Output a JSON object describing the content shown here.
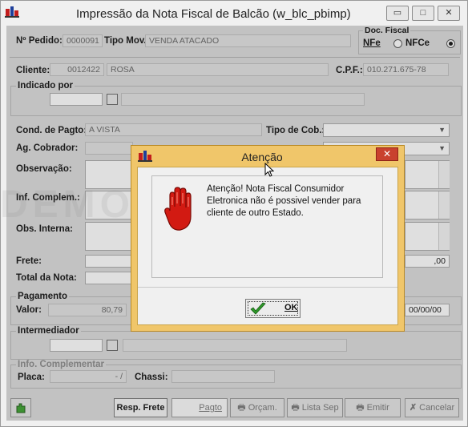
{
  "window": {
    "title": "Impressão da Nota Fiscal de Balcão (w_blc_pbimp)",
    "buttons": {
      "minimize": "▭",
      "maximize": "□",
      "close": "✕"
    }
  },
  "header": {
    "pedido_label": "Nº Pedido:",
    "pedido_value": "0000091",
    "tipo_mov_label": "Tipo Mov.:",
    "tipo_mov_value": "VENDA ATACADO",
    "doc_fiscal_label": "Doc. Fiscal",
    "nfe_label": "NFe",
    "nfce_label": "NFCe",
    "doc_fiscal_selected": "NFe"
  },
  "cliente": {
    "label": "Cliente:",
    "code": "0012422",
    "name": "ROSA",
    "cpf_label": "C.P.F.:",
    "cpf_value": "010.271.675-78"
  },
  "indicado_por": {
    "label": "Indicado por"
  },
  "form": {
    "cond_pagto_label": "Cond. de Pagto:",
    "cond_pagto_value": "A VISTA",
    "tipo_cob_label": "Tipo de Cob.:",
    "ag_cobrador_label": "Ag. Cobrador:",
    "observacao_label": "Observação:",
    "inf_complem_label": "Inf. Complem.:",
    "obs_interna_label": "Obs. Interna:",
    "frete_label": "Frete:",
    "frete_value": ",00",
    "total_nota_label": "Total da Nota:"
  },
  "pagamento": {
    "label": "Pagamento",
    "valor_label": "Valor:",
    "valor_value": "80,79",
    "date_value": "00/00/00"
  },
  "intermediador": {
    "label": "Intermediador"
  },
  "info_complementar": {
    "label": "Info. Complementar",
    "placa_label": "Placa:",
    "placa_value": "- /",
    "chassi_label": "Chassi:"
  },
  "watermark": "DEMO VERSION",
  "toolbar": {
    "resp_frete": "Resp. Frete",
    "pagto": "Pagto",
    "orcam": "Orçam.",
    "lista_sep": "Lista Sep",
    "emitir": "Emitir",
    "cancelar": "Cancelar"
  },
  "dialog": {
    "title": "Atenção",
    "message": "Atenção! Nota Fiscal Consumidor Eletronica não é possivel vender para cliente de outro Estado.",
    "ok_label": "OK",
    "close": "✕",
    "icon": "stop-hand-icon"
  },
  "colors": {
    "dialog_frame": "#f0c66a",
    "dialog_close": "#c9412e",
    "stop_hand": "#d21a12",
    "ok_check": "#2e9a2a"
  }
}
